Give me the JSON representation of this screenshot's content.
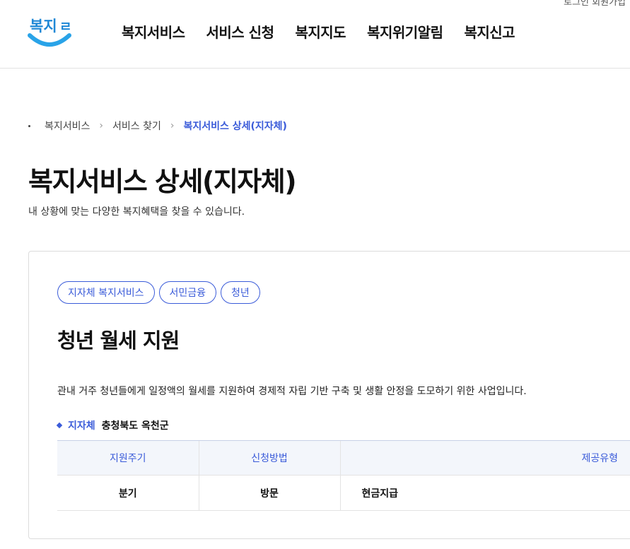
{
  "topline": {
    "text": "로그인 회원가입"
  },
  "header": {
    "logo_text": "복지로",
    "colors": {
      "logo_blue": "#1f88d6",
      "logo_smile": "#29a3e8"
    },
    "nav": [
      {
        "label": "복지서비스"
      },
      {
        "label": "서비스 신청"
      },
      {
        "label": "복지지도"
      },
      {
        "label": "복지위기알림"
      },
      {
        "label": "복지신고"
      }
    ]
  },
  "breadcrumb": {
    "items": [
      {
        "label": "복지서비스"
      },
      {
        "label": "서비스 찾기"
      }
    ],
    "current": "복지서비스 상세(지자체)"
  },
  "page": {
    "title": "복지서비스 상세(지자체)",
    "description": "내 상황에 맞는 다양한 복지혜택을 찾을 수 있습니다."
  },
  "service": {
    "tags": [
      {
        "label": "지자체 복지서비스"
      },
      {
        "label": "서민금융"
      },
      {
        "label": "청년"
      }
    ],
    "title": "청년 월세 지원",
    "description": "관내 거주 청년들에게 일정액의 월세를 지원하여 경제적 자립 기반 구축 및 생활 안정을 도모하기 위한 사업입니다.",
    "org_label": "지자체",
    "org_value": "충청북도 옥천군",
    "table": {
      "headers": [
        "지원주기",
        "신청방법",
        "제공유형"
      ],
      "row": [
        "분기",
        "방문",
        "현금지급"
      ]
    }
  },
  "colors": {
    "accent": "#3a5bd9",
    "table_header_bg": "#f3f6fb"
  }
}
